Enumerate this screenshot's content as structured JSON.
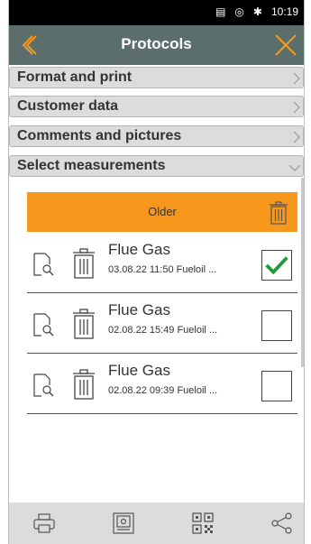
{
  "status": {
    "time": "10:19",
    "icons": [
      "sim-icon",
      "wifi-icon",
      "bluetooth-icon"
    ]
  },
  "header": {
    "title": "Protocols",
    "accent": "#f7981d",
    "bar_color": "#5c6e6c"
  },
  "sections": [
    {
      "label": "Format and print",
      "expanded": false
    },
    {
      "label": "Customer data",
      "expanded": false
    },
    {
      "label": "Comments and pictures",
      "expanded": false
    },
    {
      "label": "Select measurements",
      "expanded": true
    }
  ],
  "older": {
    "label": "Older"
  },
  "measurements": [
    {
      "name": "Flue Gas",
      "meta": "03.08.22  11:50  Fueloil ...",
      "checked": true
    },
    {
      "name": "Flue Gas",
      "meta": "02.08.22  15:49  Fueloil ...",
      "checked": false
    },
    {
      "name": "Flue Gas",
      "meta": "02.08.22  09:39  Fueloil ...",
      "checked": false
    }
  ],
  "toolbar": [
    "print-icon",
    "save-icon",
    "qr-code-icon",
    "share-icon"
  ]
}
